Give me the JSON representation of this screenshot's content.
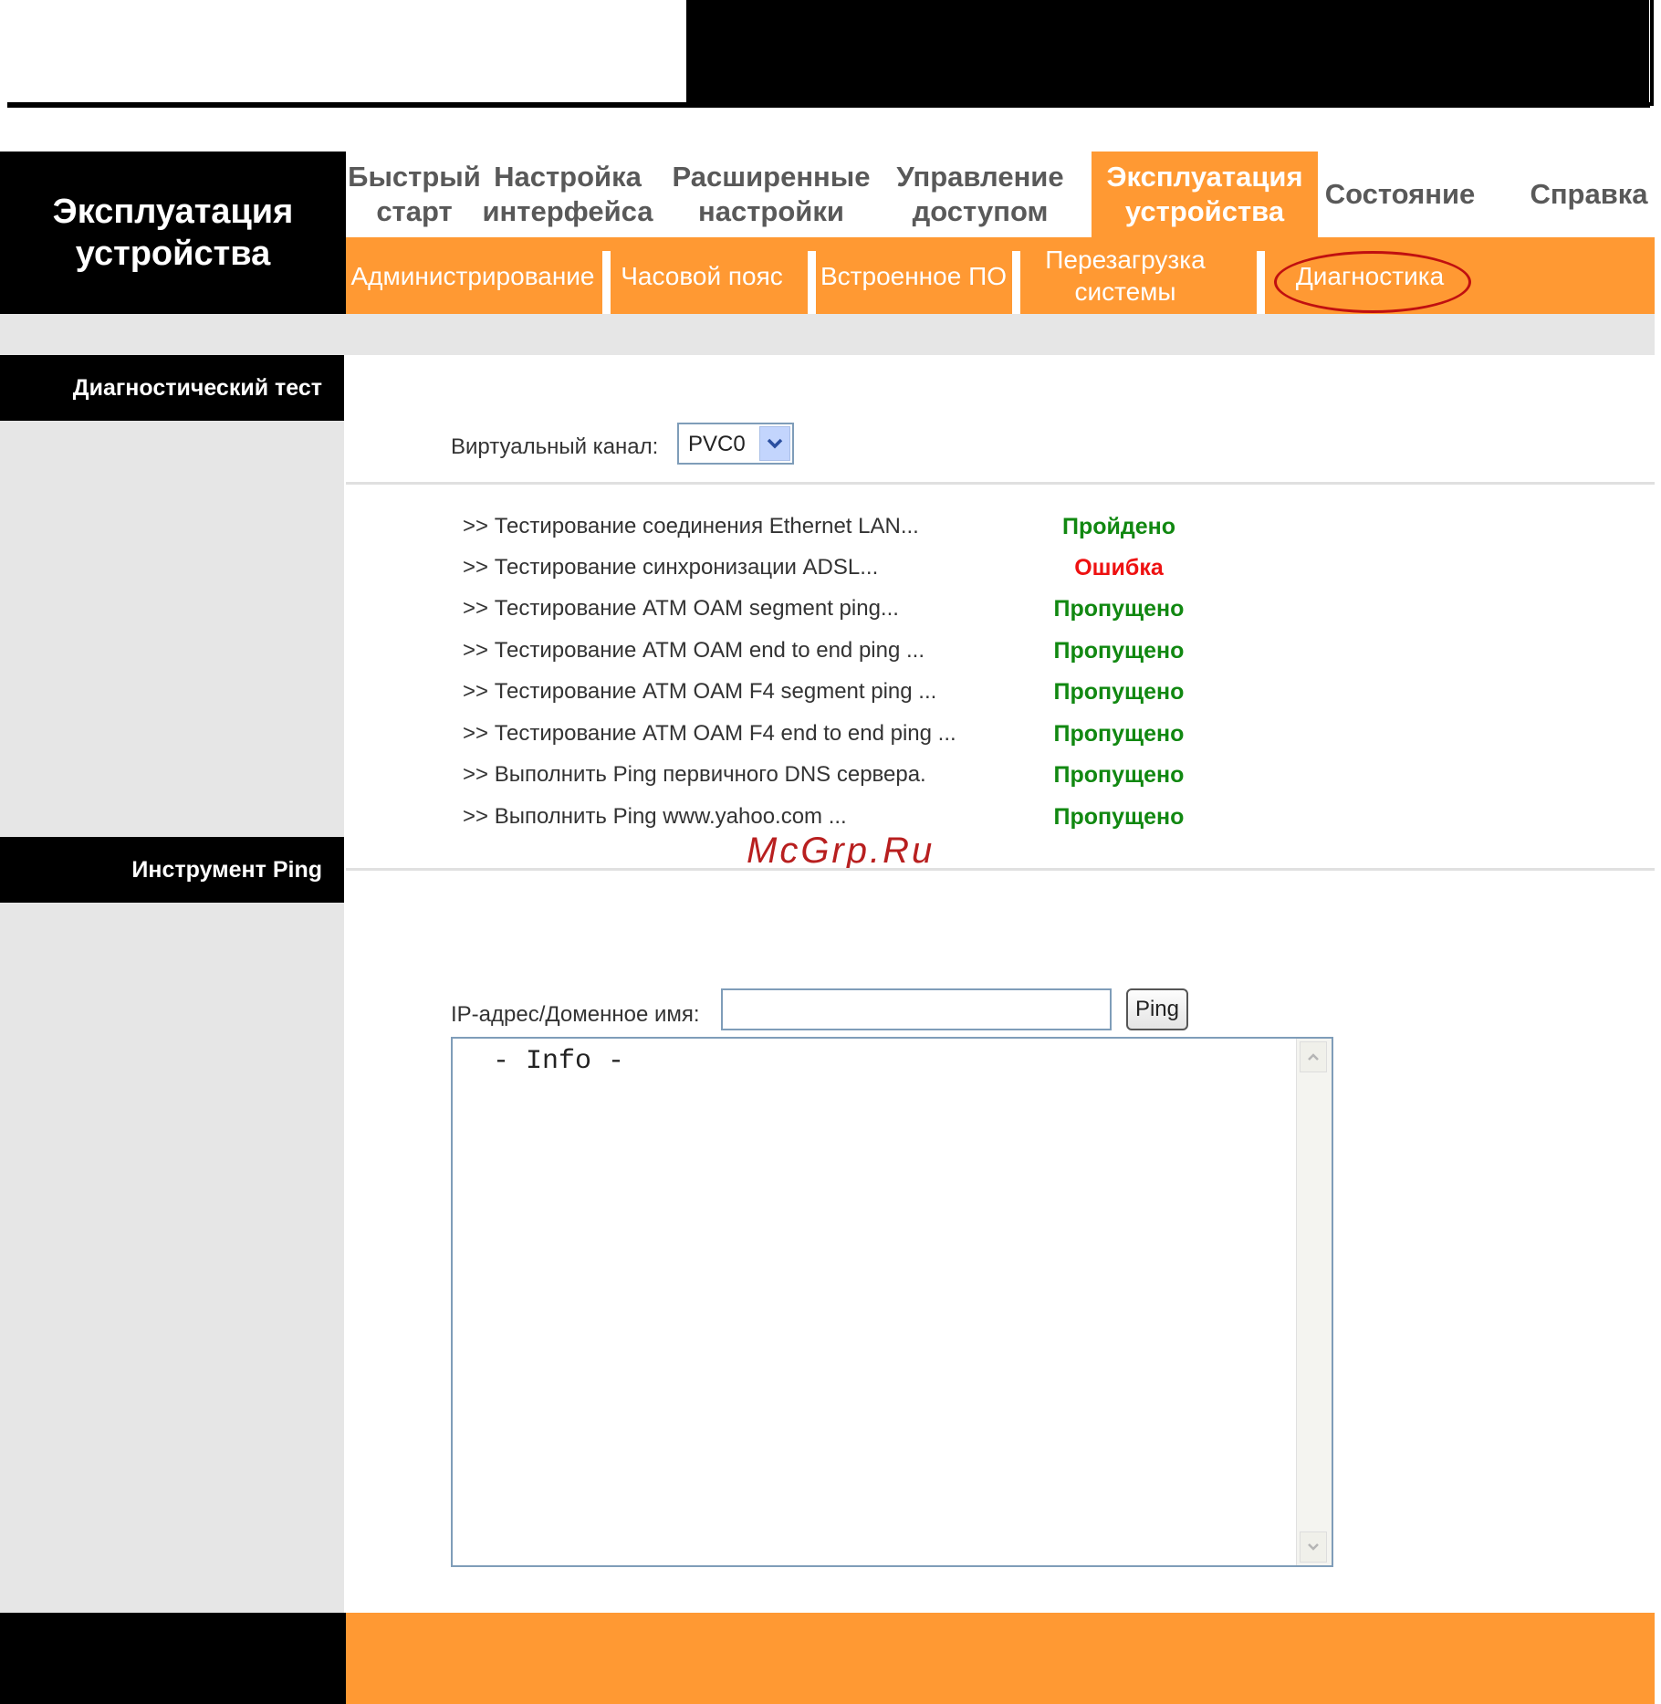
{
  "header": {
    "section_title": "Эксплуатация устройства"
  },
  "main_nav": [
    {
      "label": "Быстрый старт"
    },
    {
      "label": "Настройка интерфейса"
    },
    {
      "label": "Расширенные настройки"
    },
    {
      "label": "Управление доступом"
    },
    {
      "label": "Эксплуатация устройства",
      "active": true
    },
    {
      "label": "Состояние"
    },
    {
      "label": "Справка"
    }
  ],
  "sub_nav": [
    {
      "label": "Администрирование"
    },
    {
      "label": "Часовой пояс"
    },
    {
      "label": "Встроенное ПО"
    },
    {
      "label": "Перезагрузка системы"
    },
    {
      "label": "Диагностика",
      "active": true
    }
  ],
  "sidebar": {
    "diag_heading": "Диагностический тест",
    "ping_heading": "Инструмент Ping"
  },
  "diagnostics": {
    "virtual_channel_label": "Виртуальный канал:",
    "virtual_channel_value": "PVC0",
    "tests": [
      {
        "label": ">> Тестирование соединения Ethernet LAN...",
        "result": "Пройдено",
        "color": "#118811"
      },
      {
        "label": ">> Тестирование синхронизации ADSL...",
        "result": "Ошибка",
        "color": "#ee1111"
      },
      {
        "label": ">> Тестирование ATM OAM segment ping...",
        "result": "Пропущено",
        "color": "#118811"
      },
      {
        "label": ">> Тестирование ATM OAM end to end ping ...",
        "result": "Пропущено",
        "color": "#118811"
      },
      {
        "label": ">> Тестирование ATM OAM F4 segment ping ...",
        "result": "Пропущено",
        "color": "#118811"
      },
      {
        "label": ">> Тестирование ATM OAM F4 end to end ping ...",
        "result": "Пропущено",
        "color": "#118811"
      },
      {
        "label": ">> Выполнить Ping первичного DNS сервера.",
        "result": "Пропущено",
        "color": "#118811"
      },
      {
        "label": ">> Выполнить Ping www.yahoo.com ...",
        "result": "Пропущено",
        "color": "#118811"
      }
    ]
  },
  "ping_tool": {
    "ip_label": "IP-адрес/Доменное имя:",
    "ip_value": "",
    "ping_button": "Ping",
    "info_text": " - Info -"
  },
  "watermark": "McGrp.Ru",
  "colors": {
    "accent": "#ff9933",
    "sidebar": "#e6e6e6",
    "black": "#000000"
  }
}
